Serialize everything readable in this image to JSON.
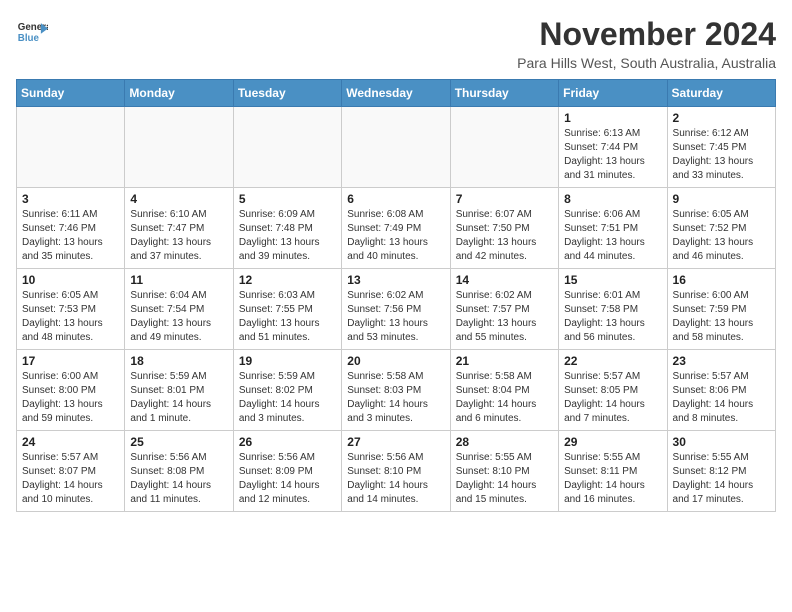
{
  "logo": {
    "general": "General",
    "blue": "Blue"
  },
  "header": {
    "month": "November 2024",
    "location": "Para Hills West, South Australia, Australia"
  },
  "days_of_week": [
    "Sunday",
    "Monday",
    "Tuesday",
    "Wednesday",
    "Thursday",
    "Friday",
    "Saturday"
  ],
  "weeks": [
    [
      {
        "day": "",
        "info": "",
        "empty": true
      },
      {
        "day": "",
        "info": "",
        "empty": true
      },
      {
        "day": "",
        "info": "",
        "empty": true
      },
      {
        "day": "",
        "info": "",
        "empty": true
      },
      {
        "day": "",
        "info": "",
        "empty": true
      },
      {
        "day": "1",
        "info": "Sunrise: 6:13 AM\nSunset: 7:44 PM\nDaylight: 13 hours and 31 minutes."
      },
      {
        "day": "2",
        "info": "Sunrise: 6:12 AM\nSunset: 7:45 PM\nDaylight: 13 hours and 33 minutes."
      }
    ],
    [
      {
        "day": "3",
        "info": "Sunrise: 6:11 AM\nSunset: 7:46 PM\nDaylight: 13 hours and 35 minutes."
      },
      {
        "day": "4",
        "info": "Sunrise: 6:10 AM\nSunset: 7:47 PM\nDaylight: 13 hours and 37 minutes."
      },
      {
        "day": "5",
        "info": "Sunrise: 6:09 AM\nSunset: 7:48 PM\nDaylight: 13 hours and 39 minutes."
      },
      {
        "day": "6",
        "info": "Sunrise: 6:08 AM\nSunset: 7:49 PM\nDaylight: 13 hours and 40 minutes."
      },
      {
        "day": "7",
        "info": "Sunrise: 6:07 AM\nSunset: 7:50 PM\nDaylight: 13 hours and 42 minutes."
      },
      {
        "day": "8",
        "info": "Sunrise: 6:06 AM\nSunset: 7:51 PM\nDaylight: 13 hours and 44 minutes."
      },
      {
        "day": "9",
        "info": "Sunrise: 6:05 AM\nSunset: 7:52 PM\nDaylight: 13 hours and 46 minutes."
      }
    ],
    [
      {
        "day": "10",
        "info": "Sunrise: 6:05 AM\nSunset: 7:53 PM\nDaylight: 13 hours and 48 minutes."
      },
      {
        "day": "11",
        "info": "Sunrise: 6:04 AM\nSunset: 7:54 PM\nDaylight: 13 hours and 49 minutes."
      },
      {
        "day": "12",
        "info": "Sunrise: 6:03 AM\nSunset: 7:55 PM\nDaylight: 13 hours and 51 minutes."
      },
      {
        "day": "13",
        "info": "Sunrise: 6:02 AM\nSunset: 7:56 PM\nDaylight: 13 hours and 53 minutes."
      },
      {
        "day": "14",
        "info": "Sunrise: 6:02 AM\nSunset: 7:57 PM\nDaylight: 13 hours and 55 minutes."
      },
      {
        "day": "15",
        "info": "Sunrise: 6:01 AM\nSunset: 7:58 PM\nDaylight: 13 hours and 56 minutes."
      },
      {
        "day": "16",
        "info": "Sunrise: 6:00 AM\nSunset: 7:59 PM\nDaylight: 13 hours and 58 minutes."
      }
    ],
    [
      {
        "day": "17",
        "info": "Sunrise: 6:00 AM\nSunset: 8:00 PM\nDaylight: 13 hours and 59 minutes."
      },
      {
        "day": "18",
        "info": "Sunrise: 5:59 AM\nSunset: 8:01 PM\nDaylight: 14 hours and 1 minute."
      },
      {
        "day": "19",
        "info": "Sunrise: 5:59 AM\nSunset: 8:02 PM\nDaylight: 14 hours and 3 minutes."
      },
      {
        "day": "20",
        "info": "Sunrise: 5:58 AM\nSunset: 8:03 PM\nDaylight: 14 hours and 3 minutes."
      },
      {
        "day": "21",
        "info": "Sunrise: 5:58 AM\nSunset: 8:04 PM\nDaylight: 14 hours and 6 minutes."
      },
      {
        "day": "22",
        "info": "Sunrise: 5:57 AM\nSunset: 8:05 PM\nDaylight: 14 hours and 7 minutes."
      },
      {
        "day": "23",
        "info": "Sunrise: 5:57 AM\nSunset: 8:06 PM\nDaylight: 14 hours and 8 minutes."
      }
    ],
    [
      {
        "day": "24",
        "info": "Sunrise: 5:57 AM\nSunset: 8:07 PM\nDaylight: 14 hours and 10 minutes."
      },
      {
        "day": "25",
        "info": "Sunrise: 5:56 AM\nSunset: 8:08 PM\nDaylight: 14 hours and 11 minutes."
      },
      {
        "day": "26",
        "info": "Sunrise: 5:56 AM\nSunset: 8:09 PM\nDaylight: 14 hours and 12 minutes."
      },
      {
        "day": "27",
        "info": "Sunrise: 5:56 AM\nSunset: 8:10 PM\nDaylight: 14 hours and 14 minutes."
      },
      {
        "day": "28",
        "info": "Sunrise: 5:55 AM\nSunset: 8:10 PM\nDaylight: 14 hours and 15 minutes."
      },
      {
        "day": "29",
        "info": "Sunrise: 5:55 AM\nSunset: 8:11 PM\nDaylight: 14 hours and 16 minutes."
      },
      {
        "day": "30",
        "info": "Sunrise: 5:55 AM\nSunset: 8:12 PM\nDaylight: 14 hours and 17 minutes."
      }
    ]
  ]
}
